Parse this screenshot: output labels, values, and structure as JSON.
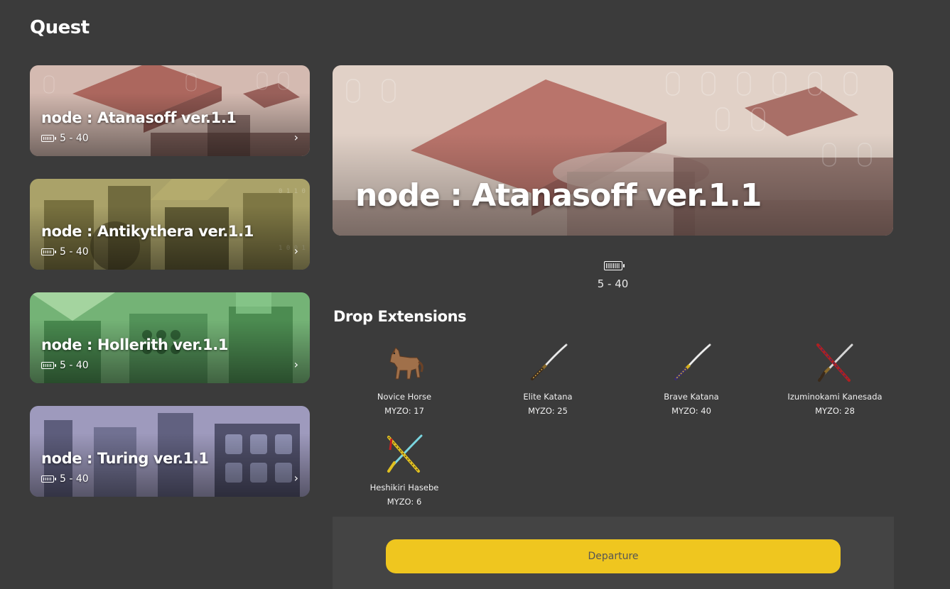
{
  "page": {
    "title": "Quest"
  },
  "quests": [
    {
      "title": "node : Atanasoff ver.1.1",
      "range": "5 - 40",
      "theme": "atanasoff"
    },
    {
      "title": "node : Antikythera ver.1.1",
      "range": "5 - 40",
      "theme": "antikythera"
    },
    {
      "title": "node : Hollerith ver.1.1",
      "range": "5 - 40",
      "theme": "hollerith"
    },
    {
      "title": "node : Turing ver.1.1",
      "range": "5 - 40",
      "theme": "turing"
    }
  ],
  "selected": {
    "title": "node : Atanasoff ver.1.1",
    "range": "5 - 40"
  },
  "drops": {
    "title": "Drop Extensions",
    "items": [
      {
        "name": "Novice Horse",
        "myzo": "MYZO: 17",
        "icon": "horse-icon"
      },
      {
        "name": "Elite Katana",
        "myzo": "MYZO: 25",
        "icon": "katana-icon"
      },
      {
        "name": "Brave Katana",
        "myzo": "MYZO: 40",
        "icon": "katana-icon"
      },
      {
        "name": "Izuminokami Kanesada",
        "myzo": "MYZO: 28",
        "icon": "crossed-swords-icon"
      },
      {
        "name": "Heshikiri Hasebe",
        "myzo": "MYZO: 6",
        "icon": "crossed-swords-icon"
      }
    ]
  },
  "action": {
    "departure_label": "Departure"
  },
  "colors": {
    "background": "#3b3b3b",
    "panel": "#444444",
    "accent": "#efc61f"
  }
}
